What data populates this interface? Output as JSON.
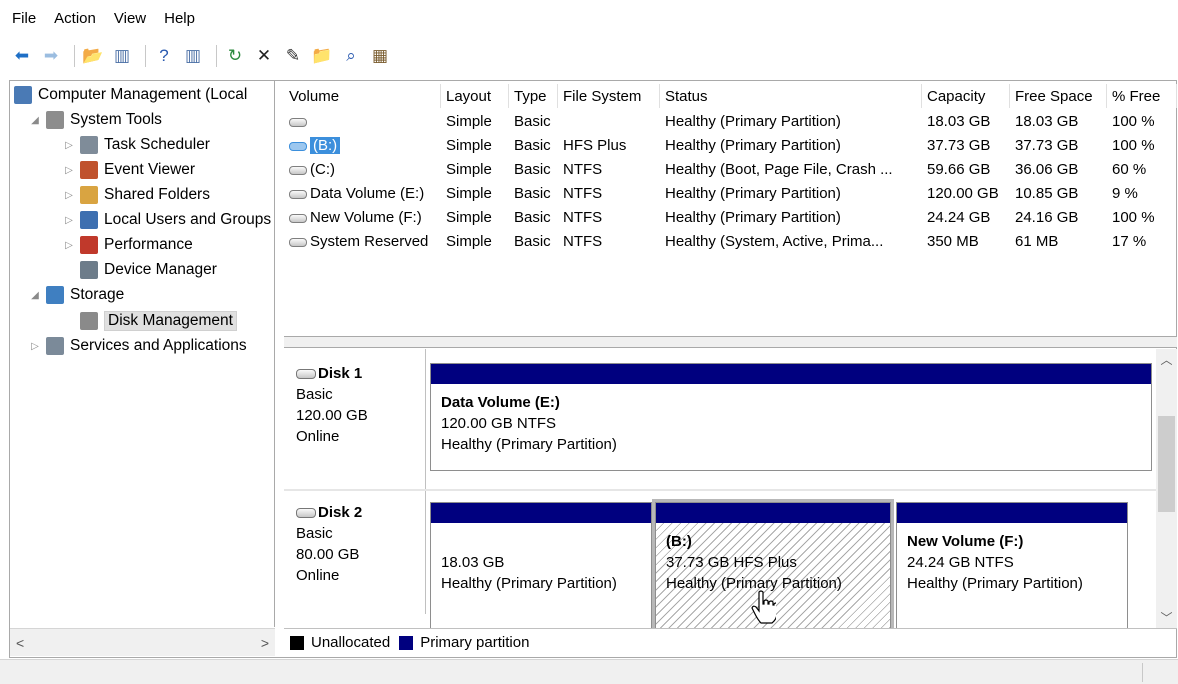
{
  "menu": [
    "File",
    "Action",
    "View",
    "Help"
  ],
  "toolbar": [
    {
      "icon": "back-arrow-icon",
      "glyph": "⬅",
      "color": "#1e6fc6"
    },
    {
      "icon": "forward-arrow-icon",
      "glyph": "➡",
      "color": "#9bbde0"
    },
    {
      "sep": true
    },
    {
      "icon": "up-folder-icon",
      "glyph": "📂",
      "color": "#e0a733"
    },
    {
      "icon": "show-hide-tree-icon",
      "glyph": "▥",
      "color": "#4a6fa5"
    },
    {
      "sep": true
    },
    {
      "icon": "help-icon",
      "glyph": "?",
      "color": "#2a5ab0"
    },
    {
      "icon": "show-hide-action-pane-icon",
      "glyph": "▥",
      "color": "#4a6fa5"
    },
    {
      "sep": true
    },
    {
      "icon": "refresh-icon",
      "glyph": "↻",
      "color": "#2b8a3e"
    },
    {
      "icon": "delete-icon",
      "glyph": "✕",
      "color": "#222222"
    },
    {
      "icon": "properties-icon",
      "glyph": "✎",
      "color": "#333333"
    },
    {
      "icon": "open-folder-icon",
      "glyph": "📁",
      "color": "#e0a733"
    },
    {
      "icon": "search-icon",
      "glyph": "⌕",
      "color": "#2a5ab0"
    },
    {
      "icon": "disk-properties-icon",
      "glyph": "▦",
      "color": "#7a5c2e"
    }
  ],
  "tree": [
    {
      "label": "Computer Management (Local",
      "depth": 0,
      "arrow": "",
      "icon": "computer-management-icon",
      "color": "#4a7ab5"
    },
    {
      "label": "System Tools",
      "depth": 1,
      "arrow": "◢",
      "icon": "system-tools-icon",
      "color": "#8d8d8d"
    },
    {
      "label": "Task Scheduler",
      "depth": 2,
      "arrow": "▷",
      "icon": "task-scheduler-icon",
      "color": "#7f8c99"
    },
    {
      "label": "Event Viewer",
      "depth": 2,
      "arrow": "▷",
      "icon": "event-viewer-icon",
      "color": "#c0522d"
    },
    {
      "label": "Shared Folders",
      "depth": 2,
      "arrow": "▷",
      "icon": "shared-folders-icon",
      "color": "#d9a441"
    },
    {
      "label": "Local Users and Groups",
      "depth": 2,
      "arrow": "▷",
      "icon": "users-icon",
      "color": "#3d6fb0"
    },
    {
      "label": "Performance",
      "depth": 2,
      "arrow": "▷",
      "icon": "performance-icon",
      "color": "#c0392b"
    },
    {
      "label": "Device Manager",
      "depth": 2,
      "arrow": "",
      "icon": "device-manager-icon",
      "color": "#6d7c8a"
    },
    {
      "label": "Storage",
      "depth": 1,
      "arrow": "◢",
      "icon": "storage-icon",
      "color": "#3f7fc1"
    },
    {
      "label": "Disk Management",
      "depth": 2,
      "arrow": "",
      "icon": "disk-management-icon",
      "color": "#8a8a8a",
      "selected": true
    },
    {
      "label": "Services and Applications",
      "depth": 1,
      "arrow": "▷",
      "icon": "services-icon",
      "color": "#7b8a99"
    }
  ],
  "tree_scroll": {
    "left": "<",
    "right": ">"
  },
  "volume_columns": [
    "Volume",
    "Layout",
    "Type",
    "File System",
    "Status",
    "Capacity",
    "Free Space",
    "% Free"
  ],
  "volumes": [
    {
      "volume": "",
      "layout": "Simple",
      "type": "Basic",
      "fs": "",
      "status": "Healthy (Primary Partition)",
      "capacity": "18.03 GB",
      "free": "18.03 GB",
      "pct": "100 %"
    },
    {
      "volume": "(B:)",
      "layout": "Simple",
      "type": "Basic",
      "fs": "HFS Plus",
      "status": "Healthy (Primary Partition)",
      "capacity": "37.73 GB",
      "free": "37.73 GB",
      "pct": "100 %",
      "selected": true
    },
    {
      "volume": "(C:)",
      "layout": "Simple",
      "type": "Basic",
      "fs": "NTFS",
      "status": "Healthy (Boot, Page File, Crash ...",
      "capacity": "59.66 GB",
      "free": "36.06 GB",
      "pct": "60 %"
    },
    {
      "volume": "Data Volume (E:)",
      "layout": "Simple",
      "type": "Basic",
      "fs": "NTFS",
      "status": "Healthy (Primary Partition)",
      "capacity": "120.00 GB",
      "free": "10.85 GB",
      "pct": "9 %"
    },
    {
      "volume": "New Volume (F:)",
      "layout": "Simple",
      "type": "Basic",
      "fs": "NTFS",
      "status": "Healthy (Primary Partition)",
      "capacity": "24.24 GB",
      "free": "24.16 GB",
      "pct": "100 %"
    },
    {
      "volume": "System Reserved",
      "layout": "Simple",
      "type": "Basic",
      "fs": "NTFS",
      "status": "Healthy (System, Active, Prima...",
      "capacity": "350 MB",
      "free": "61 MB",
      "pct": "17 %"
    }
  ],
  "disks": [
    {
      "name": "Disk 1",
      "kind": "Basic",
      "size": "120.00 GB",
      "state": "Online",
      "partitions": [
        {
          "title": "Data Volume  (E:)",
          "line2": "120.00 GB NTFS",
          "line3": "Healthy (Primary Partition)"
        }
      ]
    },
    {
      "name": "Disk 2",
      "kind": "Basic",
      "size": "80.00 GB",
      "state": "Online",
      "partitions": [
        {
          "title": "",
          "line2": "18.03 GB",
          "line3": "Healthy (Primary Partition)"
        },
        {
          "title": "(B:)",
          "line2": "37.73 GB HFS Plus",
          "line3": "Healthy (Primary Partition)",
          "selected": true
        },
        {
          "title": "New Volume  (F:)",
          "line2": "24.24 GB NTFS",
          "line3": "Healthy (Primary Partition)"
        }
      ]
    }
  ],
  "legend": [
    {
      "label": "Unallocated",
      "color": "#000000"
    },
    {
      "label": "Primary partition",
      "color": "#00007f"
    }
  ],
  "colors": {
    "partition_bar": "#00007f",
    "selection": "#3c8fdc"
  }
}
